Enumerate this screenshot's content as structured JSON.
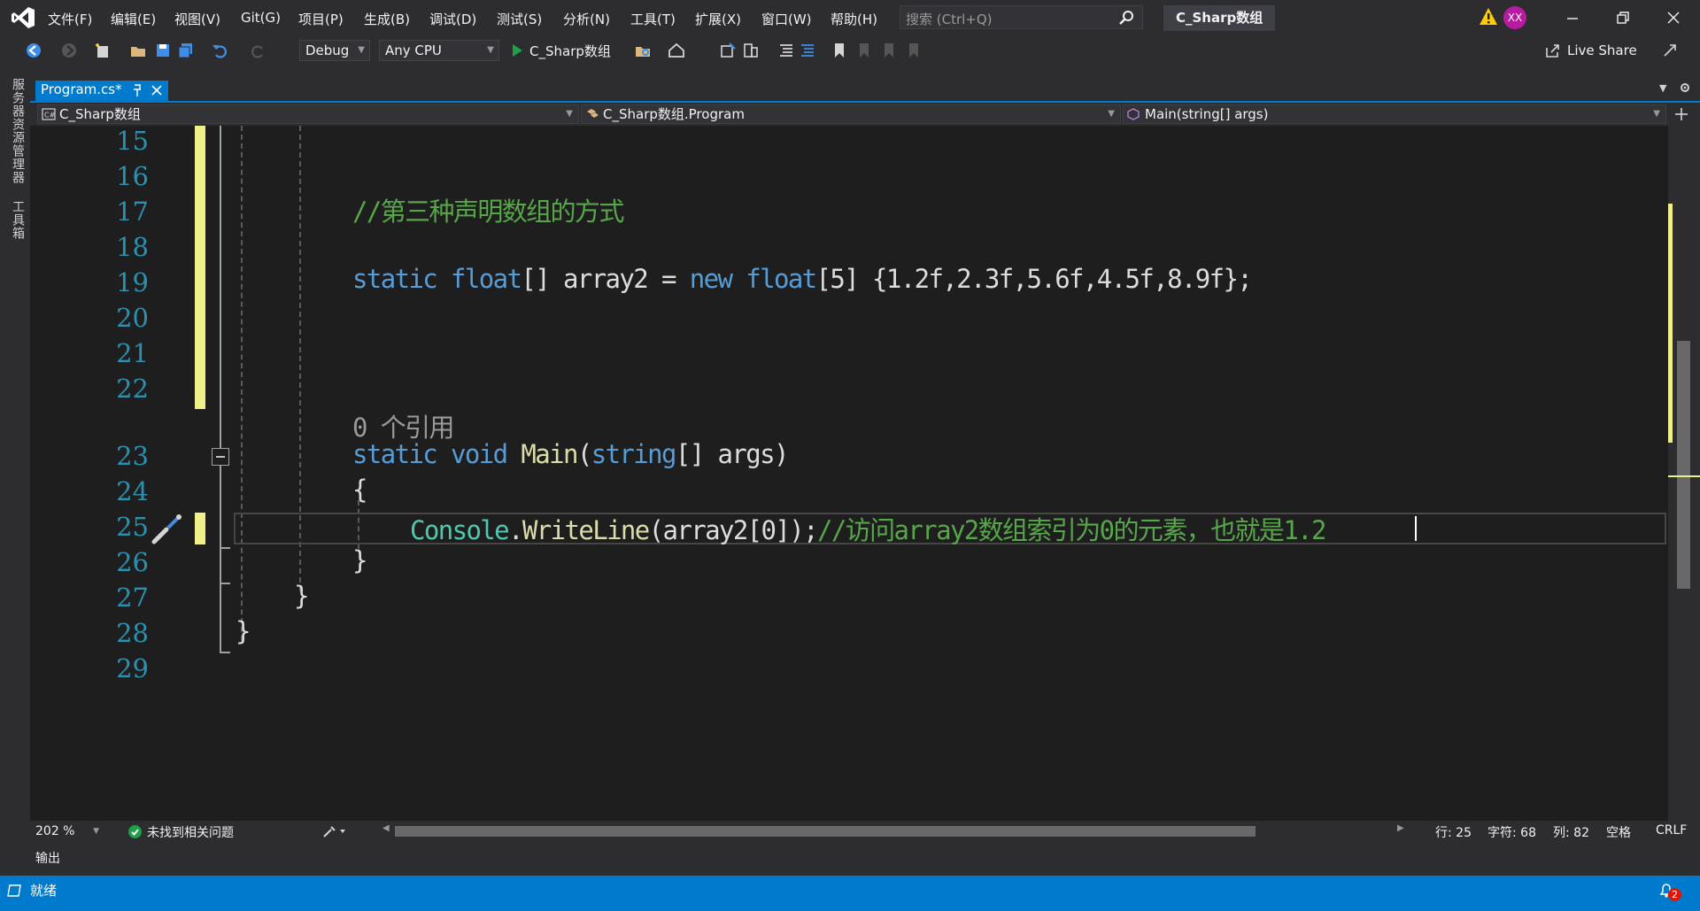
{
  "menu": {
    "items": [
      "文件(F)",
      "编辑(E)",
      "视图(V)",
      "Git(G)",
      "项目(P)",
      "生成(B)",
      "调试(D)",
      "测试(S)",
      "分析(N)",
      "工具(T)",
      "扩展(X)",
      "窗口(W)",
      "帮助(H)"
    ]
  },
  "search": {
    "placeholder": "搜索 (Ctrl+Q)"
  },
  "solution_title": "C_Sharp数组",
  "avatar_initials": "XX",
  "toolbar": {
    "configuration": "Debug",
    "platform": "Any CPU",
    "startup_project": "C_Sharp数组",
    "live_share": "Live Share"
  },
  "side_tabs": [
    "服务器资源管理器",
    "工具箱"
  ],
  "document_tab": {
    "label": "Program.cs*"
  },
  "navbar": {
    "project": "C_Sharp数组",
    "type": "C_Sharp数组.Program",
    "member": "Main(string[] args)"
  },
  "editor": {
    "line_numbers": [
      "15",
      "16",
      "17",
      "18",
      "19",
      "20",
      "21",
      "22",
      "23",
      "24",
      "25",
      "26",
      "27",
      "28",
      "29"
    ],
    "comment_line17": "//第三种声明数组的方式",
    "line19": {
      "kw_static": "static",
      "kw_float": "float",
      "brackets": "[]",
      "name": "array2",
      "eq": "=",
      "kw_new": "new",
      "kw_float2": "float",
      "size": "[5]",
      "values": "{1.2f,2.3f,5.6f,4.5f,8.9f};"
    },
    "codelens": "0 个引用",
    "line23": {
      "kw_static": "static",
      "kw_void": "void",
      "method": "Main",
      "paren_open": "(",
      "kw_string": "string",
      "brackets": "[]",
      "param": "args",
      "paren_close": ")"
    },
    "line24_brace": "{",
    "line25": {
      "type": "Console",
      "dot": ".",
      "method": "WriteLine",
      "args": "(array2[0]);",
      "comment": "//访问array2数组索引为0的元素，也就是1.2"
    },
    "line26_brace": "}",
    "line27_brace": "}",
    "line28_brace": "}"
  },
  "editor_status": {
    "zoom": "202 %",
    "issues": "未找到相关问题",
    "line": "行: 25",
    "char": "字符: 68",
    "col": "列: 82",
    "whitespace": "空格",
    "line_ending": "CRLF"
  },
  "output_tab": "输出",
  "status": {
    "text": "就绪",
    "notifications": "2"
  }
}
